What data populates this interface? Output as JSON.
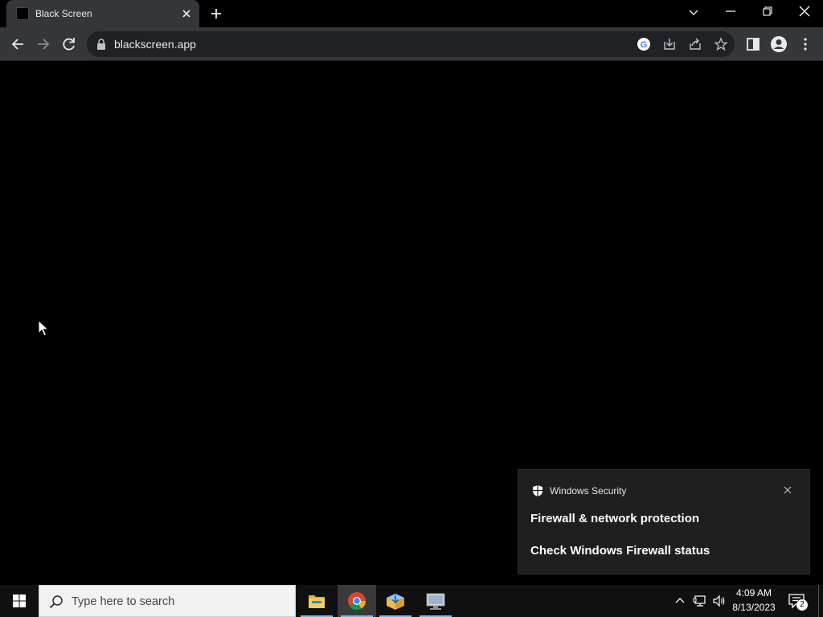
{
  "browser": {
    "tab": {
      "title": "Black Screen"
    },
    "address": {
      "url": "blackscreen.app"
    }
  },
  "toast": {
    "app_name": "Windows Security",
    "title": "Firewall & network protection",
    "body": "Check Windows Firewall status"
  },
  "taskbar": {
    "search_placeholder": "Type here to search",
    "apps": [
      "file-explorer",
      "chrome",
      "app-installer",
      "remote-desktop"
    ],
    "clock": {
      "time": "4:09 AM",
      "date": "8/13/2023"
    },
    "notification_count": "2"
  },
  "colors": {
    "toolbar": "#35363a",
    "omnibox": "#202124",
    "toast_bg": "#1f1f1f",
    "taskbar_bg": "#101010",
    "accent": "#76b9ed"
  }
}
